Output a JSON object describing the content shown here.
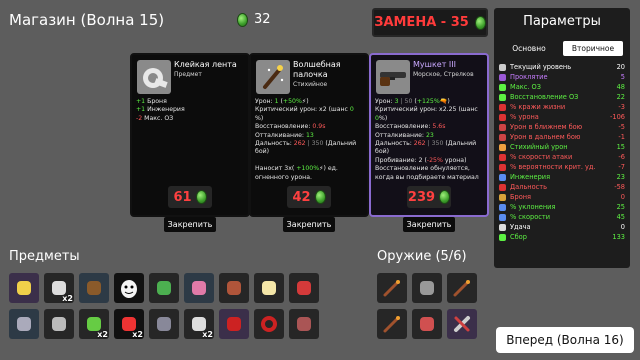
{
  "header": {
    "title": "Магазин (Волна 15)",
    "coins": "32",
    "reroll_label": "ЗАМЕНА - 35"
  },
  "cards": [
    {
      "name": "Клейкая лента",
      "type": "Предмет",
      "icon": "tape-icon",
      "price": "61",
      "desc": [
        [
          "g",
          "+1"
        ],
        [
          "",
          " Броня"
        ],
        [
          "br",
          ""
        ],
        [
          "g",
          "+1"
        ],
        [
          "",
          " Инженерия"
        ],
        [
          "br",
          ""
        ],
        [
          "r",
          "-2"
        ],
        [
          "",
          " Макс. ОЗ"
        ]
      ],
      "lock_label": "Закрепить"
    },
    {
      "name": "Волшебная палочка",
      "type": "Стихийное",
      "icon": "wand-icon",
      "price": "42",
      "desc": [
        [
          "",
          "Урон: "
        ],
        [
          "g",
          "1"
        ],
        [
          "",
          " ("
        ],
        [
          "g",
          "+50%"
        ],
        [
          "",
          "⚡)"
        ],
        [
          "br",
          ""
        ],
        [
          "",
          "Критический урон: x2 (шанс "
        ],
        [
          "g",
          "0"
        ],
        [
          "",
          ""
        ],
        [
          "br",
          ""
        ],
        [
          "",
          "%)"
        ],
        [
          "br",
          ""
        ],
        [
          "",
          "Восстановление: "
        ],
        [
          "r",
          "0.9s"
        ],
        [
          "br",
          ""
        ],
        [
          "",
          "Отталкивание: "
        ],
        [
          "g",
          "13"
        ],
        [
          "br",
          ""
        ],
        [
          "",
          "Дальность: "
        ],
        [
          "r",
          "262"
        ],
        [
          "gr",
          " | 350"
        ],
        [
          "",
          " (Дальний бой)"
        ],
        [
          "br",
          ""
        ],
        [
          "br",
          ""
        ],
        [
          "",
          "Наносит 3x( "
        ],
        [
          "g",
          "+100%"
        ],
        [
          "",
          "⚡) ед. огненного урона."
        ]
      ],
      "lock_label": "Закрепить"
    },
    {
      "name": "Мушкет III",
      "type": "Морское, Стрелков",
      "icon": "musket-icon",
      "price": "239",
      "desc": [
        [
          "",
          "Урон: "
        ],
        [
          "g",
          "3"
        ],
        [
          "gr",
          " | 50"
        ],
        [
          "",
          " ("
        ],
        [
          "g",
          "+125%"
        ],
        [
          "",
          "🔫)"
        ],
        [
          "br",
          ""
        ],
        [
          "",
          "Критический урон: x2.25 (шанс "
        ],
        [
          "g",
          "0"
        ],
        [
          "",
          "%)"
        ],
        [
          "br",
          ""
        ],
        [
          "",
          "Восстановление: "
        ],
        [
          "r",
          "5.6s"
        ],
        [
          "br",
          ""
        ],
        [
          "",
          "Отталкивание: "
        ],
        [
          "g",
          "23"
        ],
        [
          "br",
          ""
        ],
        [
          "",
          "Дальность: "
        ],
        [
          "r",
          "262"
        ],
        [
          "gr",
          " | 350"
        ],
        [
          "",
          " (Дальний бой)"
        ],
        [
          "br",
          ""
        ],
        [
          "",
          "Пробивание: 2 ("
        ],
        [
          "r",
          "-25%"
        ],
        [
          "",
          " урона)"
        ],
        [
          "br",
          ""
        ],
        [
          "",
          "Восстановление обнуляется, когда вы подбираете материал"
        ]
      ],
      "lock_label": "Закрепить"
    }
  ],
  "params": {
    "title": "Параметры",
    "tabs": [
      "Основно",
      "Вторичное"
    ],
    "stats": [
      {
        "label": "Текущий уровень",
        "value": "20",
        "color": "#ffffff",
        "icon": "#cccccc"
      },
      {
        "label": "Проклятие",
        "value": "5",
        "color": "#c77dff",
        "icon": "#9b59d6"
      },
      {
        "label": "Макс. ОЗ",
        "value": "48",
        "color": "#5df043",
        "icon": "#5df043"
      },
      {
        "label": "Восстановление ОЗ",
        "value": "22",
        "color": "#5df043",
        "icon": "#5df043"
      },
      {
        "label": "% кражи жизни",
        "value": "-3",
        "color": "#ff5a5a",
        "icon": "#d33"
      },
      {
        "label": "% урона",
        "value": "-106",
        "color": "#ff5a5a",
        "icon": "#d33"
      },
      {
        "label": "Урон в ближнем бою",
        "value": "-5",
        "color": "#ff5a5a",
        "icon": "#c44"
      },
      {
        "label": "Урон в дальнем бою",
        "value": "-1",
        "color": "#ff5a5a",
        "icon": "#c44"
      },
      {
        "label": "Стихийный урон",
        "value": "15",
        "color": "#5df043",
        "icon": "#f0a040"
      },
      {
        "label": "% скорости атаки",
        "value": "-6",
        "color": "#ff5a5a",
        "icon": "#d33"
      },
      {
        "label": "% вероятности крит. уд.",
        "value": "-7",
        "color": "#ff5a5a",
        "icon": "#d33"
      },
      {
        "label": "Инженерия",
        "value": "23",
        "color": "#5df043",
        "icon": "#5a8cf0"
      },
      {
        "label": "Дальность",
        "value": "-58",
        "color": "#ff5a5a",
        "icon": "#d33"
      },
      {
        "label": "Броня",
        "value": "0",
        "color": "#ff5a5a",
        "icon": "#d8a33a"
      },
      {
        "label": "% уклонения",
        "value": "25",
        "color": "#5df043",
        "icon": "#5a8cf0"
      },
      {
        "label": "% скорости",
        "value": "45",
        "color": "#5df043",
        "icon": "#5a8cf0"
      },
      {
        "label": "Удача",
        "value": "0",
        "color": "#ffffff",
        "icon": "#dddddd"
      },
      {
        "label": "Сбор",
        "value": "133",
        "color": "#5df043",
        "icon": "#5df043"
      }
    ]
  },
  "items_label": "Предметы",
  "weapons_label": "Оружие (5/6)",
  "items": [
    {
      "icon": "duck-icon",
      "bg": "p",
      "count": ""
    },
    {
      "icon": "drone-icon",
      "bg": "n",
      "count": "x2"
    },
    {
      "icon": "hammer-gear-icon",
      "bg": "b",
      "count": ""
    },
    {
      "icon": "egg-face-icon",
      "bg": "k",
      "count": ""
    },
    {
      "icon": "battery-icon",
      "bg": "n",
      "count": ""
    },
    {
      "icon": "octopus-icon",
      "bg": "b",
      "count": ""
    },
    {
      "icon": "sausage-icon",
      "bg": "n",
      "count": ""
    },
    {
      "icon": "fish-icon",
      "bg": "n",
      "count": ""
    },
    {
      "icon": "blood-icon",
      "bg": "n",
      "count": ""
    },
    {
      "icon": "spring-icon",
      "bg": "b",
      "count": ""
    },
    {
      "icon": "hook-icon",
      "bg": "n",
      "count": ""
    },
    {
      "icon": "leaf-icon",
      "bg": "n",
      "count": "x2"
    },
    {
      "icon": "dots-icon",
      "bg": "k",
      "count": "x2"
    },
    {
      "icon": "robot-icon",
      "bg": "n",
      "count": ""
    },
    {
      "icon": "skull-icon",
      "bg": "n",
      "count": "x2"
    },
    {
      "icon": "claw-icon",
      "bg": "p",
      "count": ""
    },
    {
      "icon": "ring-icon",
      "bg": "n",
      "count": ""
    },
    {
      "icon": "mushroom-icon",
      "bg": "n",
      "count": ""
    }
  ],
  "weapons": [
    {
      "icon": "wand-weapon-icon",
      "bg": "n"
    },
    {
      "icon": "bag-weapon-icon",
      "bg": "n"
    },
    {
      "icon": "wand2-weapon-icon",
      "bg": "n"
    },
    {
      "icon": "wand3-weapon-icon",
      "bg": "n"
    },
    {
      "icon": "turret-weapon-icon",
      "bg": "n"
    },
    {
      "icon": "wrench-weapon-icon",
      "bg": "p"
    }
  ],
  "next_label": "Вперед (Волна 16)"
}
